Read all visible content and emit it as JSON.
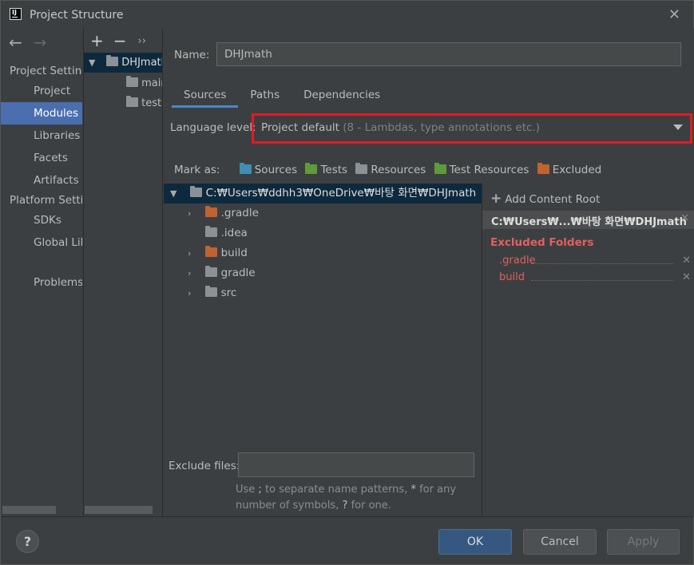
{
  "window": {
    "title": "Project Structure",
    "app_icon_text": "IJ"
  },
  "nav": {
    "back_icon": "←",
    "forward_icon": "→",
    "section_project": "Project Settings",
    "items_project": [
      "Project",
      "Modules",
      "Libraries",
      "Facets",
      "Artifacts"
    ],
    "selected": "Modules",
    "section_platform": "Platform Settings",
    "items_platform": [
      "SDKs",
      "Global Libraries"
    ],
    "problems": "Problems"
  },
  "modules": {
    "add_icon": "+",
    "remove_icon": "−",
    "more_icon": "››",
    "root": "DHJmath",
    "children": [
      "main",
      "test"
    ]
  },
  "main": {
    "name_label": "Name:",
    "name_value": "DHJmath",
    "tabs": [
      "Sources",
      "Paths",
      "Dependencies"
    ],
    "active_tab": "Sources",
    "language_level_label": "Language level:",
    "language_level_value": "Project default",
    "language_level_hint": "(8 - Lambdas, type annotations etc.)",
    "mark_as_label": "Mark as:",
    "mark_as": [
      {
        "label": "Sources",
        "color": "#3f8fb5"
      },
      {
        "label": "Tests",
        "color": "#5f9a3b"
      },
      {
        "label": "Resources",
        "color": "#8c9196"
      },
      {
        "label": "Test Resources",
        "color": "#5f9a3b"
      },
      {
        "label": "Excluded",
        "color": "#c0632f"
      }
    ],
    "tree_root": "C:₩Users₩ddhh3₩OneDrive₩바탕 화면₩DHJmath",
    "tree_items": [
      {
        "label": ".gradle",
        "color": "orange",
        "expandable": true
      },
      {
        "label": ".idea",
        "color": "gray",
        "expandable": false
      },
      {
        "label": "build",
        "color": "orange",
        "expandable": true
      },
      {
        "label": "gradle",
        "color": "gray",
        "expandable": true
      },
      {
        "label": "src",
        "color": "gray",
        "expandable": true
      }
    ],
    "exclude_files_label": "Exclude files:",
    "exclude_files_value": "",
    "exclude_help_1": "Use ",
    "exclude_help_sep": ";",
    "exclude_help_2": " to separate name patterns, ",
    "exclude_help_star": "*",
    "exclude_help_3": " for any number of symbols, ",
    "exclude_help_q": "?",
    "exclude_help_4": " for one."
  },
  "content_root": {
    "add_label": "Add Content Root",
    "path": "C:₩Users₩...₩바탕 화면₩DHJmath",
    "excluded_title": "Excluded Folders",
    "excluded": [
      ".gradle",
      "build"
    ]
  },
  "footer": {
    "help": "?",
    "ok": "OK",
    "cancel": "Cancel",
    "apply": "Apply"
  }
}
